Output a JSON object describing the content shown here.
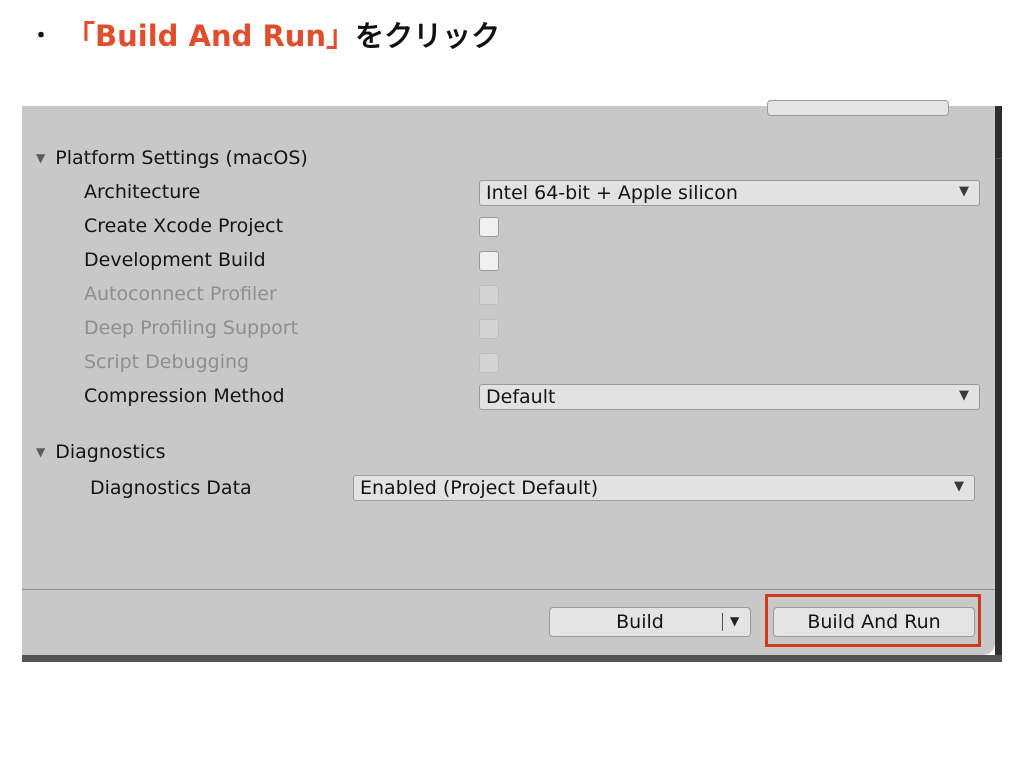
{
  "instruction": {
    "bullet": "・",
    "accent_text": "「Build And Run」",
    "rest_text": "をクリック"
  },
  "platform_section": {
    "title": "Platform Settings (macOS)",
    "rows": [
      {
        "label": "Architecture",
        "control": "dropdown",
        "value": "Intel 64-bit + Apple silicon"
      },
      {
        "label": "Create Xcode Project",
        "control": "checkbox",
        "checked": false,
        "enabled": true
      },
      {
        "label": "Development Build",
        "control": "checkbox",
        "checked": false,
        "enabled": true
      },
      {
        "label": "Autoconnect Profiler",
        "control": "checkbox",
        "checked": false,
        "enabled": false
      },
      {
        "label": "Deep Profiling Support",
        "control": "checkbox",
        "checked": false,
        "enabled": false
      },
      {
        "label": "Script Debugging",
        "control": "checkbox",
        "checked": false,
        "enabled": false
      },
      {
        "label": "Compression Method",
        "control": "dropdown",
        "value": "Default"
      }
    ]
  },
  "diagnostics_section": {
    "title": "Diagnostics",
    "data_label": "Diagnostics Data",
    "data_value": "Enabled (Project Default)"
  },
  "footer": {
    "build_label": "Build",
    "build_and_run_label": "Build And Run"
  },
  "colors": {
    "accent": "#e14e2c",
    "highlight_border": "#d0391f",
    "panel_bg": "#c8c8c8"
  }
}
